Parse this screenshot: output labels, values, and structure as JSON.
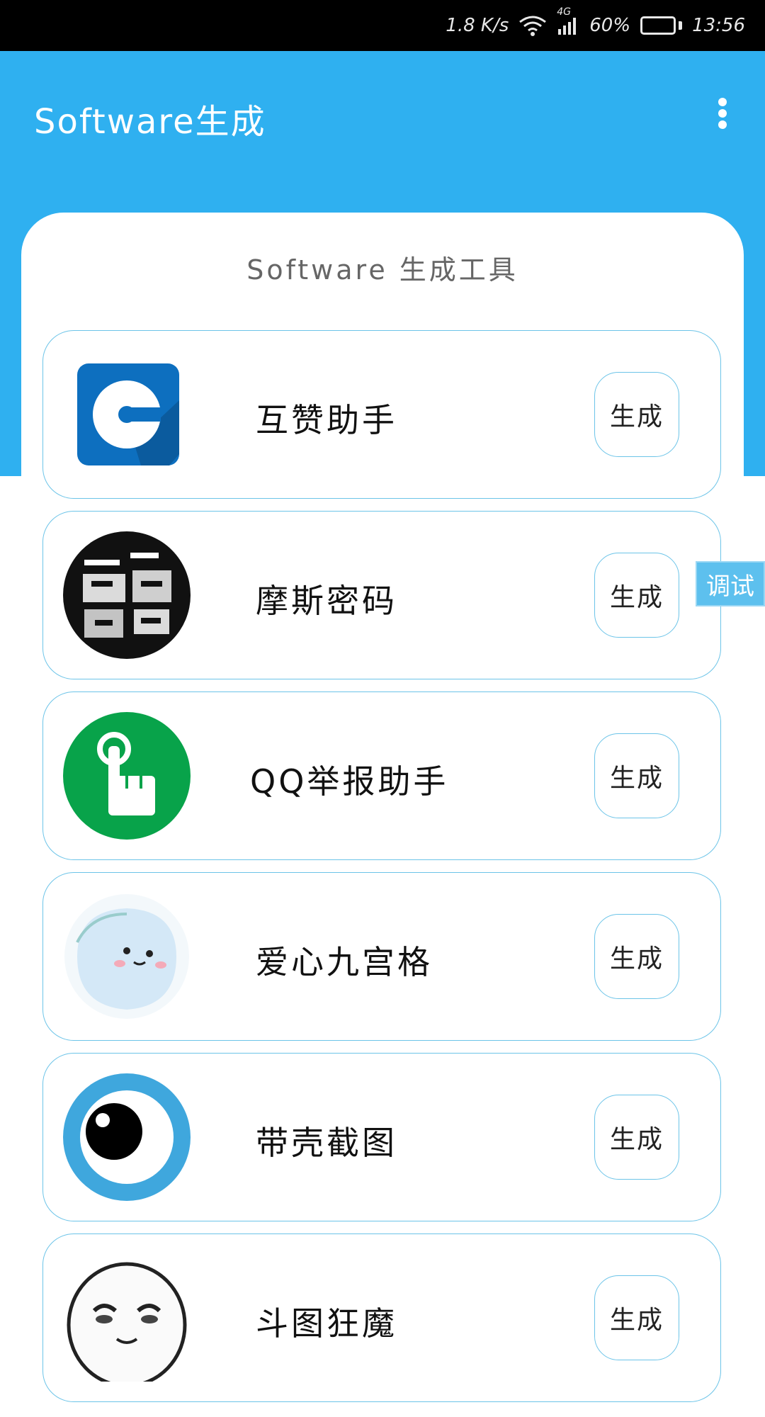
{
  "status_bar": {
    "speed": "1.8 K/s",
    "network": "4G",
    "battery_percent": "60%",
    "battery_level": 0.6,
    "time": "13:56"
  },
  "app_bar": {
    "title": "Software生成",
    "menu_icon": "more-vert-icon",
    "color": "#2fb0f0"
  },
  "card": {
    "title": "Software 生成工具"
  },
  "items": [
    {
      "name": "互赞助手",
      "icon": "like-helper-app-icon",
      "button": "生成"
    },
    {
      "name": "摩斯密码",
      "icon": "morse-code-app-icon",
      "button": "生成"
    },
    {
      "name": "QQ举报助手",
      "icon": "qq-report-app-icon",
      "button": "生成"
    },
    {
      "name": "爱心九宫格",
      "icon": "heart-grid-app-icon",
      "button": "生成"
    },
    {
      "name": "带壳截图",
      "icon": "shell-screenshot-app-icon",
      "button": "生成"
    },
    {
      "name": "斗图狂魔",
      "icon": "meme-app-icon",
      "button": "生成"
    }
  ],
  "debug_tab": {
    "label": "调试"
  }
}
